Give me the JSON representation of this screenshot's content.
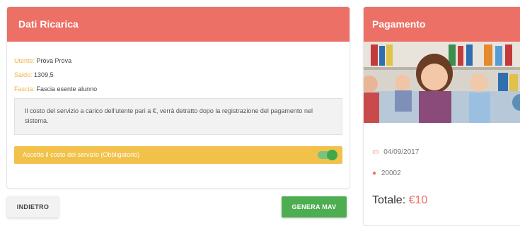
{
  "dati": {
    "title": "Dati Ricarica",
    "utente_label": "Utente:",
    "utente_value": "Prova Prova",
    "saldo_label": "Saldo:",
    "saldo_value": "1309,5",
    "fascia_label": "Fascia:",
    "fascia_value": "Fascia esente alunno",
    "notice": "Il costo del servizio a carico dell'utente pari a €, verrà detratto dopo la registrazione del pagamento nel sistema.",
    "accept_label": "Accetto il costo del servizio (Obbligatorio)",
    "accept_checked": true
  },
  "buttons": {
    "back": "INDIETRO",
    "generate": "GENERA MAV"
  },
  "pagamento": {
    "title": "Pagamento",
    "date": "04/09/2017",
    "code": "20002",
    "total_label": "Totale",
    "total_sep": ": ",
    "total_value": "€10"
  },
  "icons": {
    "date": "calendar-icon",
    "code": "user-icon"
  },
  "colors": {
    "header": "#ec7066",
    "accent": "#f0b34a",
    "accept_bar": "#f1c14a",
    "generate_button": "#4cae50"
  }
}
